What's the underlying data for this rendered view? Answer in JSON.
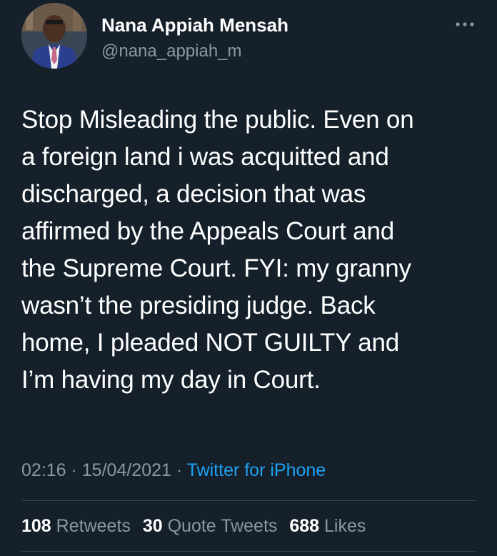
{
  "user": {
    "display_name": "Nana Appiah Mensah",
    "handle": "@nana_appiah_m",
    "avatar_icon": "profile-photo"
  },
  "menu": {
    "icon": "more-horizontal-icon"
  },
  "tweet": {
    "lines": [
      "Stop Misleading the public. Even on",
      "a foreign land i was acquitted and",
      "discharged, a decision that was",
      "affirmed by the Appeals Court and",
      "the Supreme Court. FYI: my granny",
      "wasn’t the presiding judge. Back",
      "home, I pleaded NOT GUILTY and",
      "I’m having my day in Court."
    ],
    "time": "02:16",
    "separator": " · ",
    "date": "15/04/2021",
    "source": "Twitter for iPhone"
  },
  "stats": {
    "retweets_count": "108",
    "retweets_label": "Retweets",
    "quote_count": "30",
    "quote_label": "Quote Tweets",
    "likes_count": "688",
    "likes_label": "Likes"
  },
  "colors": {
    "background": "#15202b",
    "text": "#ffffff",
    "secondary": "#8899a6",
    "accent": "#1da1f2",
    "divider": "#38444d"
  }
}
